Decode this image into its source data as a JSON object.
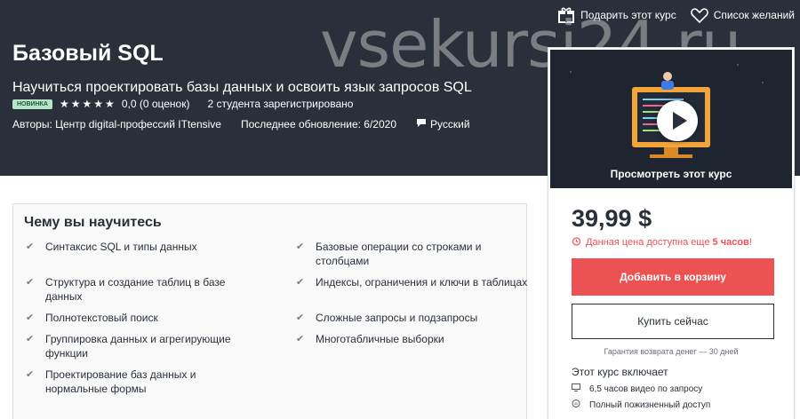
{
  "topbar": {
    "gift_label": "Подарить этот курс",
    "wishlist_label": "Список желаний"
  },
  "watermark": "vsekursi24.ru",
  "course": {
    "title": "Базовый SQL",
    "subtitle": "Научиться проектировать базы данных и освоить язык запросов SQL",
    "badge": "новинка",
    "rating_text": "0,0 (0 оценок)",
    "rating_value": 0,
    "stars_total": 5,
    "students": "2 студента зарегистрировано",
    "authors": "Авторы: Центр digital-профессий ITtensive",
    "updated": "Последнее обновление: 6/2020",
    "language": "Русский"
  },
  "learn": {
    "title": "Чему вы научитесь",
    "left": [
      "Синтаксис SQL и типы данных",
      "Структура и создание таблиц в базе данных",
      "Полнотекстовый поиск",
      "Группировка данных и агрегирующие функции",
      "Проектирование баз данных и нормальные формы"
    ],
    "right": [
      "Базовые операции со строками и столбцами",
      "Индексы, ограничения и ключи в таблицах",
      "Сложные запросы и подзапросы",
      "Многотабличные выборки"
    ]
  },
  "sidebar": {
    "preview_label": "Просмотреть этот курс",
    "price": "39,99 $",
    "timer_prefix": "Данная цена доступна еще",
    "timer_bold": "5 часов",
    "timer_suffix": "!",
    "add_to_cart": "Добавить в корзину",
    "buy_now": "Купить сейчас",
    "guarantee": "Гарантия возврата денег — 30 дней",
    "includes_title": "Этот курс включает",
    "includes": [
      "6,5 часов видео по запросу",
      "Полный пожизненный доступ"
    ]
  },
  "colors": {
    "hero_bg": "#29303b",
    "accent_red": "#ec5252",
    "badge_bg": "#b7e4c7"
  }
}
